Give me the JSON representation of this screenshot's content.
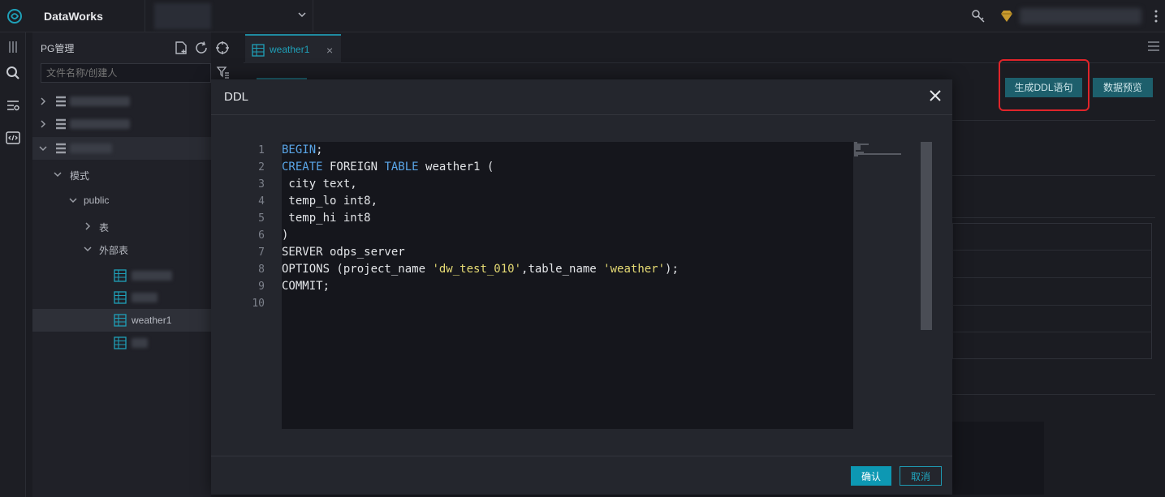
{
  "app": {
    "name": "DataWorks"
  },
  "header": {
    "project_selector_value": "",
    "icons": [
      "key-icon",
      "vip-badge-icon",
      "more-icon"
    ]
  },
  "sidebar": {
    "title": "PG管理",
    "search_placeholder": "文件名称/创建人",
    "tree": {
      "schema_label": "模式",
      "public_label": "public",
      "tables_label": "表",
      "foreign_tables_label": "外部表",
      "selected_table": "weather1"
    }
  },
  "editor": {
    "tab_label": "weather1",
    "generate_ddl_label": "生成DDL语句",
    "data_preview_label": "数据预览"
  },
  "modal": {
    "title": "DDL",
    "line_numbers": [
      "1",
      "2",
      "3",
      "4",
      "5",
      "6",
      "7",
      "8",
      "9",
      "10"
    ],
    "confirm_label": "确认",
    "cancel_label": "取消"
  },
  "colors": {
    "accent": "#0d98b3",
    "highlight_border": "#e0242a",
    "keyword": "#5aa6e8",
    "string": "#e6db74"
  }
}
